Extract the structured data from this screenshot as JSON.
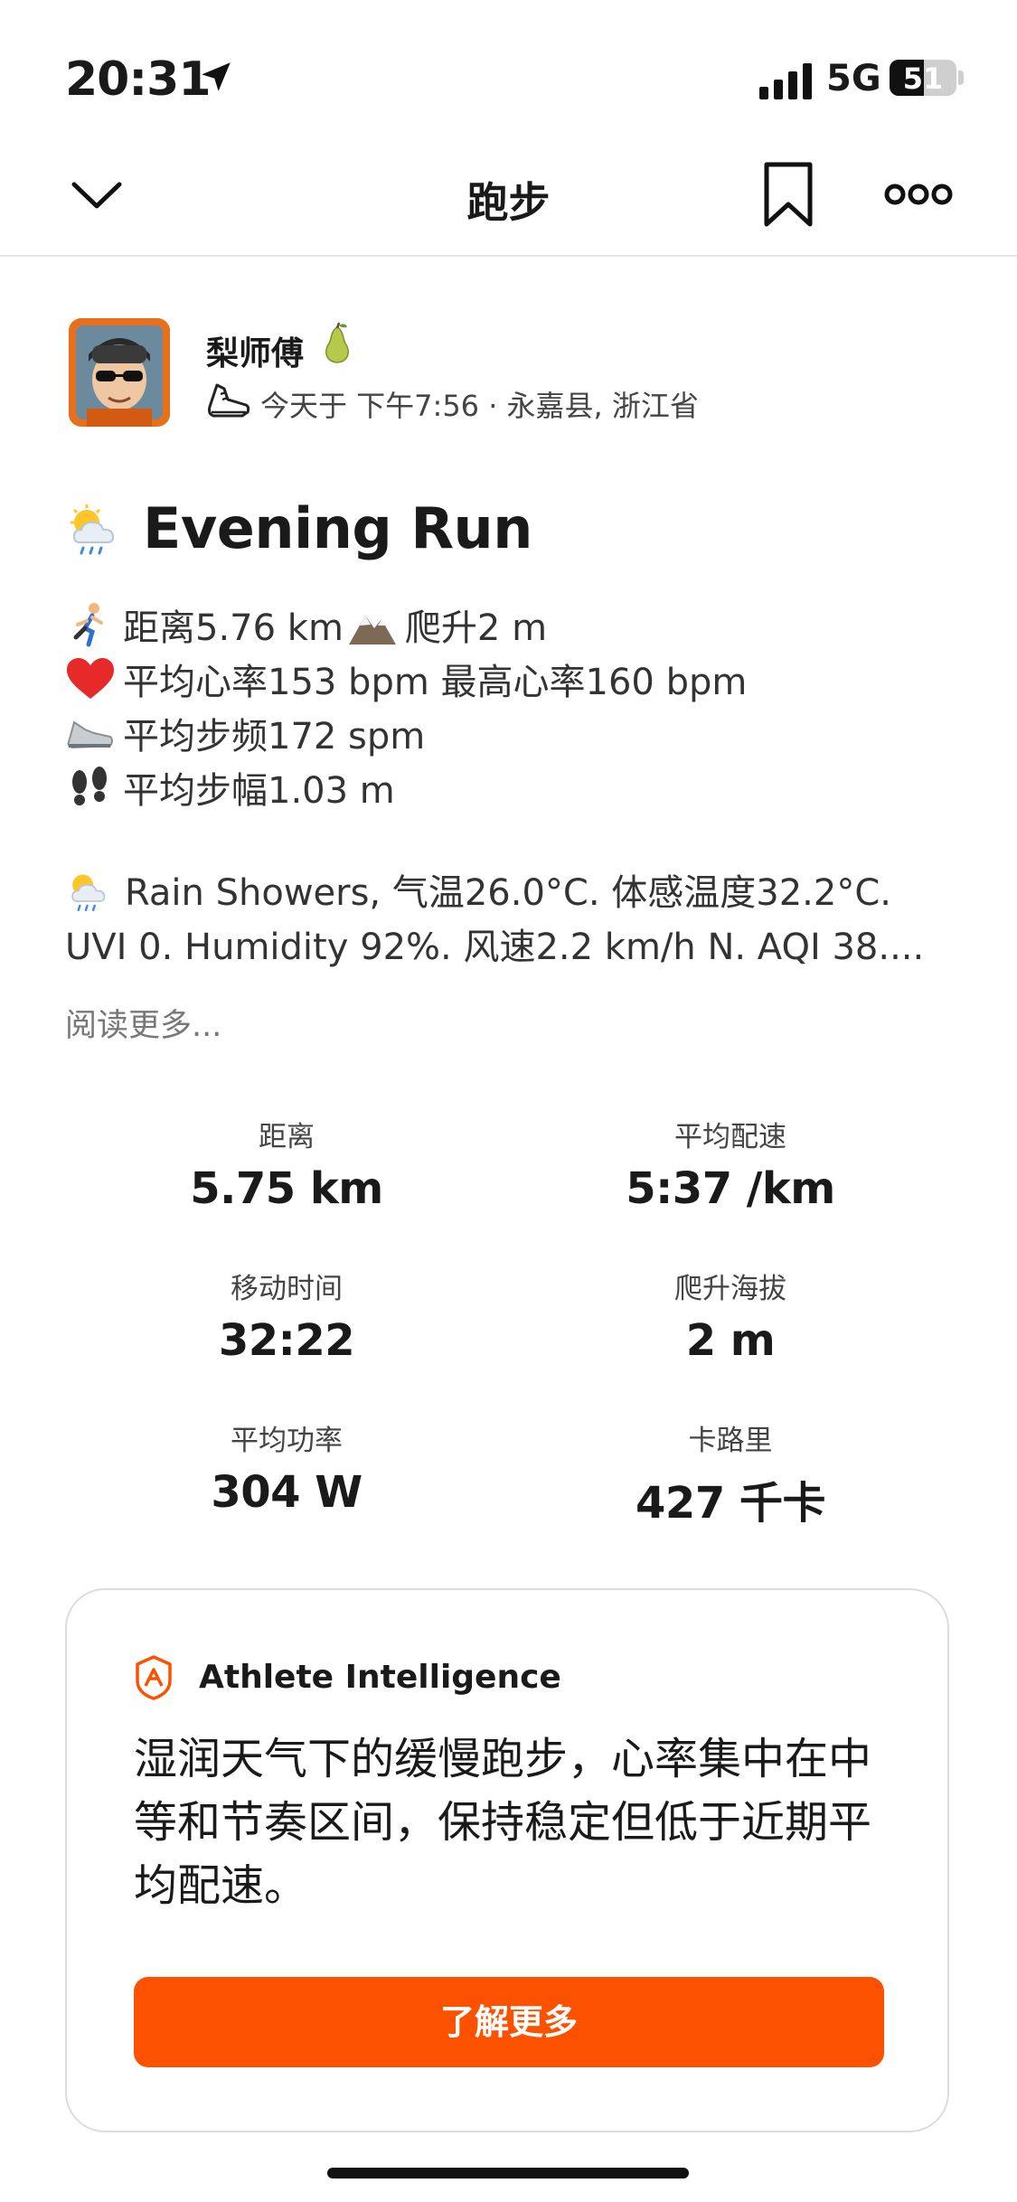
{
  "status_bar": {
    "time": "20:31",
    "network": "5G",
    "battery": "51"
  },
  "nav": {
    "title": "跑步"
  },
  "author": {
    "name": "梨师傅",
    "meta": "今天于 下午7:56 · 永嘉县, 浙江省"
  },
  "activity": {
    "title": "Evening Run",
    "lines": [
      {
        "icon": "runner-emoji",
        "text": "距离5.76 km"
      },
      {
        "icon": "mountain-emoji",
        "text": "爬升2 m"
      },
      {
        "icon": "heart-emoji",
        "text": "平均心率153 bpm 最高心率160 bpm"
      },
      {
        "icon": "shoe-emoji",
        "text": "平均步频172 spm"
      },
      {
        "icon": "footprints-emoji",
        "text": "平均步幅1.03 m"
      }
    ],
    "weather_line1": "Rain Showers, 气温26.0°C. 体感温度32.2°C.",
    "weather_line2": "UVI 0. Humidity 92%. 风速2.2 km/h N. AQI 38....",
    "read_more": "阅读更多..."
  },
  "stats": [
    {
      "label": "距离",
      "value": "5.75 km"
    },
    {
      "label": "平均配速",
      "value": "5:37 /km"
    },
    {
      "label": "移动时间",
      "value": "32:22"
    },
    {
      "label": "爬升海拔",
      "value": "2 m"
    },
    {
      "label": "平均功率",
      "value": "304 W"
    },
    {
      "label": "卡路里",
      "value": "427 千卡"
    }
  ],
  "ai_card": {
    "title": "Athlete Intelligence",
    "body": "湿润天气下的缓慢跑步，心率集中在中等和节奏区间，保持稳定但低于近期平均配速。",
    "button": "了解更多"
  },
  "colors": {
    "accent": "#fc5200",
    "text": "#1a1a1a",
    "muted": "#777777"
  }
}
